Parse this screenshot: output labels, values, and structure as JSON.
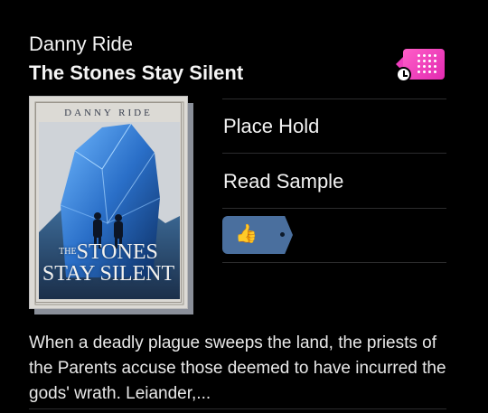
{
  "book": {
    "author": "Danny Ride",
    "title": "The Stones Stay Silent",
    "format_icon": "ebook-waitlist-icon",
    "cover": {
      "author_text": "DANNY RIDE",
      "title_small": "THE",
      "title_line1": "STONES",
      "title_line2": "STAY SILENT"
    },
    "description": "When a deadly plague sweeps the land, the priests of the Parents accuse those deemed to have incurred the gods' wrath. Leiander,..."
  },
  "actions": {
    "place_hold": "Place Hold",
    "read_sample": "Read Sample",
    "rating_icon": "thumbs-up-icon"
  },
  "colors": {
    "background": "#000000",
    "format_badge": "#e22ab1",
    "rating_tag": "#4a6f9e"
  }
}
